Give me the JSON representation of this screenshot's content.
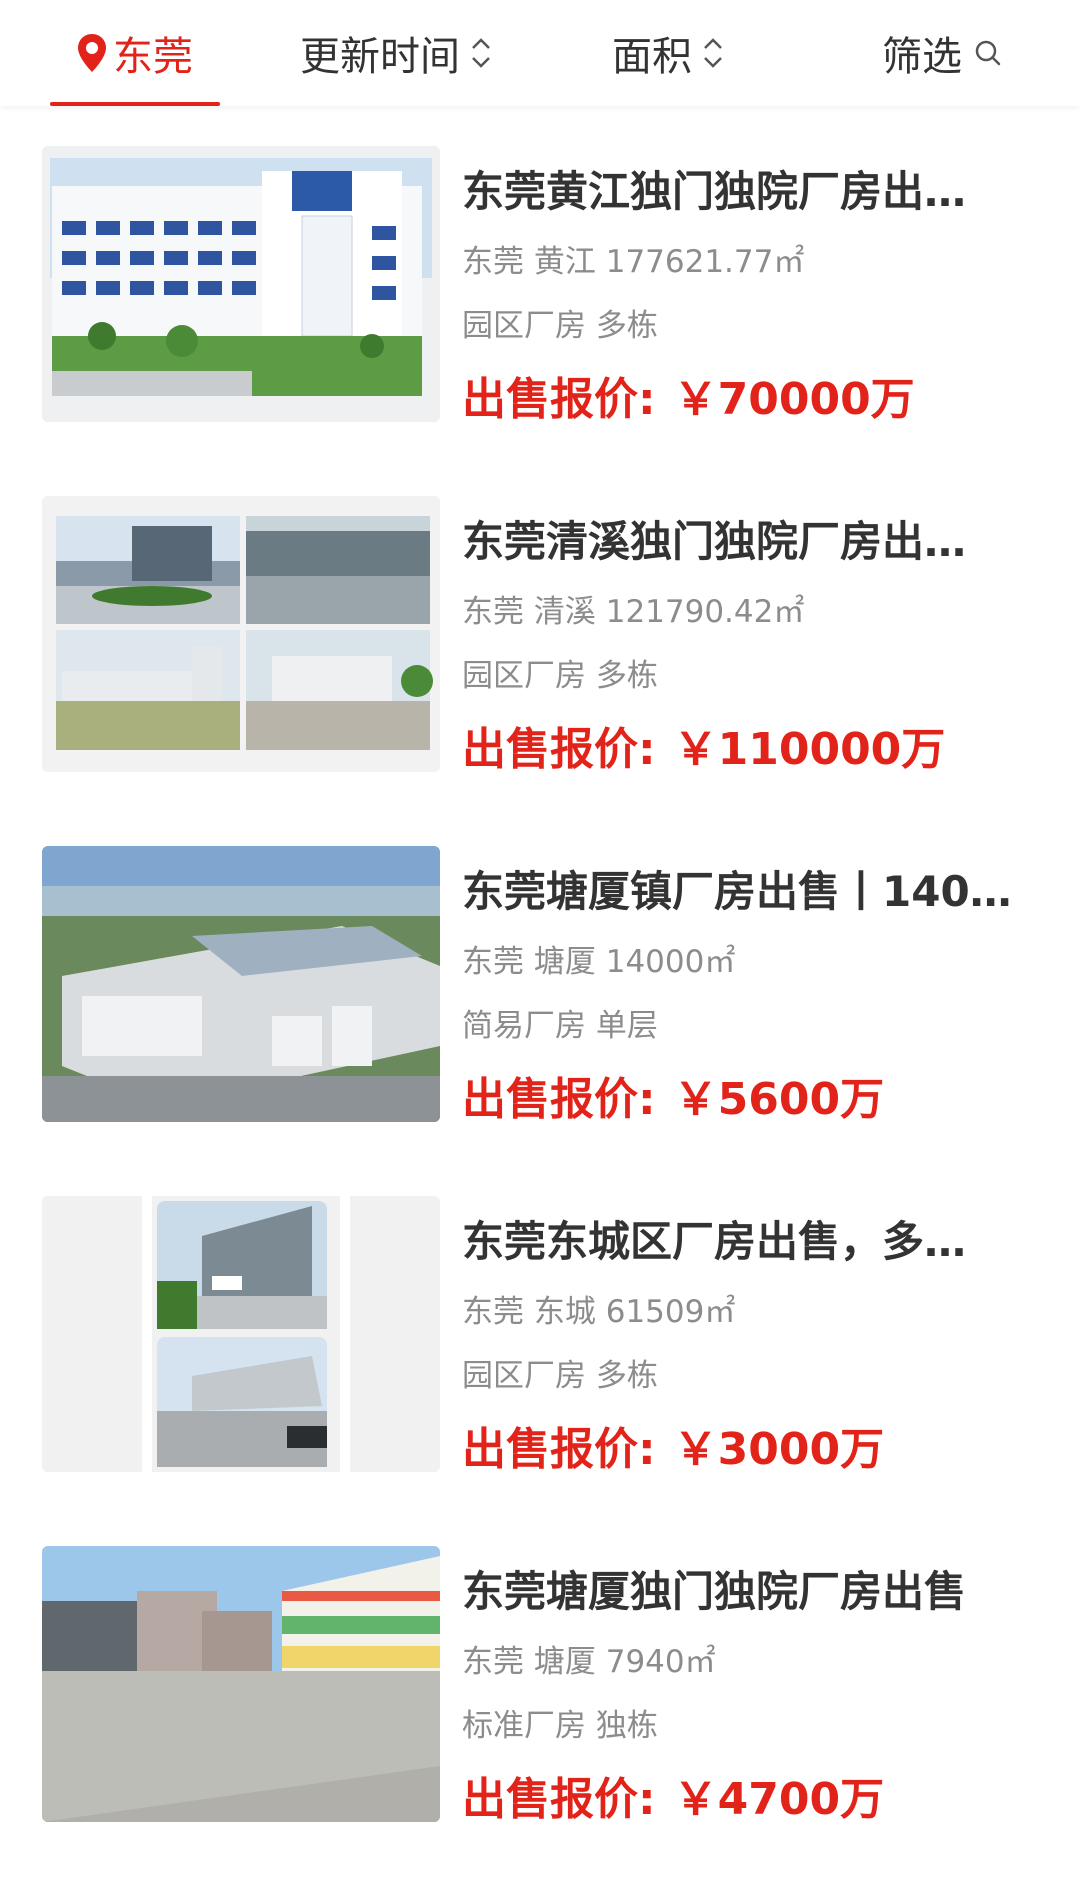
{
  "filter_bar": {
    "location": "东莞",
    "update_time": "更新时间",
    "area": "面积",
    "filter": "筛选",
    "accent_color": "#e2231a"
  },
  "icons": {
    "location": "location-pin-icon",
    "sort": "sort-updown-icon",
    "search": "search-icon"
  },
  "listings": [
    {
      "title": "东莞黄江独门独院厂房出…",
      "city": "东莞",
      "district": "黄江",
      "area": "177621.77㎡",
      "type": "园区厂房 多栋",
      "price_prefix": "出售报价:",
      "price": "￥70000万"
    },
    {
      "title": "东莞清溪独门独院厂房出…",
      "city": "东莞",
      "district": "清溪",
      "area": "121790.42㎡",
      "type": "园区厂房 多栋",
      "price_prefix": "出售报价:",
      "price": "￥110000万"
    },
    {
      "title": "东莞塘厦镇厂房出售丨140…",
      "city": "东莞",
      "district": "塘厦",
      "area": "14000㎡",
      "type": "简易厂房 单层",
      "price_prefix": "出售报价:",
      "price": "￥5600万"
    },
    {
      "title": "东莞东城区厂房出售，多…",
      "city": "东莞",
      "district": "东城",
      "area": "61509㎡",
      "type": "园区厂房 多栋",
      "price_prefix": "出售报价:",
      "price": "￥3000万"
    },
    {
      "title": "东莞塘厦独门独院厂房出售",
      "city": "东莞",
      "district": "塘厦",
      "area": "7940㎡",
      "type": "标准厂房 独栋",
      "price_prefix": "出售报价:",
      "price": "￥4700万"
    }
  ]
}
